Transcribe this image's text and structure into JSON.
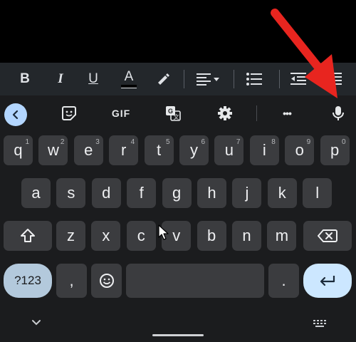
{
  "format_toolbar": {
    "icons": [
      "bold-icon",
      "italic-icon",
      "underline-icon",
      "text-color-icon",
      "highlight-icon",
      "align-icon",
      "bullet-list-icon",
      "outdent-icon",
      "indent-icon"
    ],
    "bold_label": "B",
    "italic_label": "I",
    "underline_label": "U",
    "text_color_label": "A"
  },
  "suggestion_bar": {
    "icons": [
      "back-chevron-icon",
      "sticker-icon",
      "translate-icon",
      "gear-icon",
      "more-icon",
      "mic-icon"
    ],
    "gif_label": "GIF",
    "more_label": "•••"
  },
  "keyboard": {
    "row1": [
      {
        "k": "q",
        "n": "1"
      },
      {
        "k": "w",
        "n": "2"
      },
      {
        "k": "e",
        "n": "3"
      },
      {
        "k": "r",
        "n": "4"
      },
      {
        "k": "t",
        "n": "5"
      },
      {
        "k": "y",
        "n": "6"
      },
      {
        "k": "u",
        "n": "7"
      },
      {
        "k": "i",
        "n": "8"
      },
      {
        "k": "o",
        "n": "9"
      },
      {
        "k": "p",
        "n": "0"
      }
    ],
    "row2": [
      "a",
      "s",
      "d",
      "f",
      "g",
      "h",
      "j",
      "k",
      "l"
    ],
    "row3": [
      "z",
      "x",
      "c",
      "v",
      "b",
      "n",
      "m"
    ],
    "symbols_label": "?123",
    "comma_label": ",",
    "period_label": ".",
    "shift_icon": "shift-icon",
    "backspace_icon": "backspace-icon",
    "emoji_icon": "emoji-icon",
    "enter_icon": "enter-icon"
  },
  "annotation": {
    "arrow_color": "#e8251f",
    "pointer_icon": "mouse-pointer-icon"
  },
  "nav_bar": {
    "icons": [
      "chevron-down-icon",
      "keyboard-switch-icon"
    ]
  },
  "colors": {
    "key": "#3b3c3f",
    "background": "#1b1c1e",
    "accent_pill": "#cce7ff",
    "symbols_pill": "#b3c9dc"
  }
}
